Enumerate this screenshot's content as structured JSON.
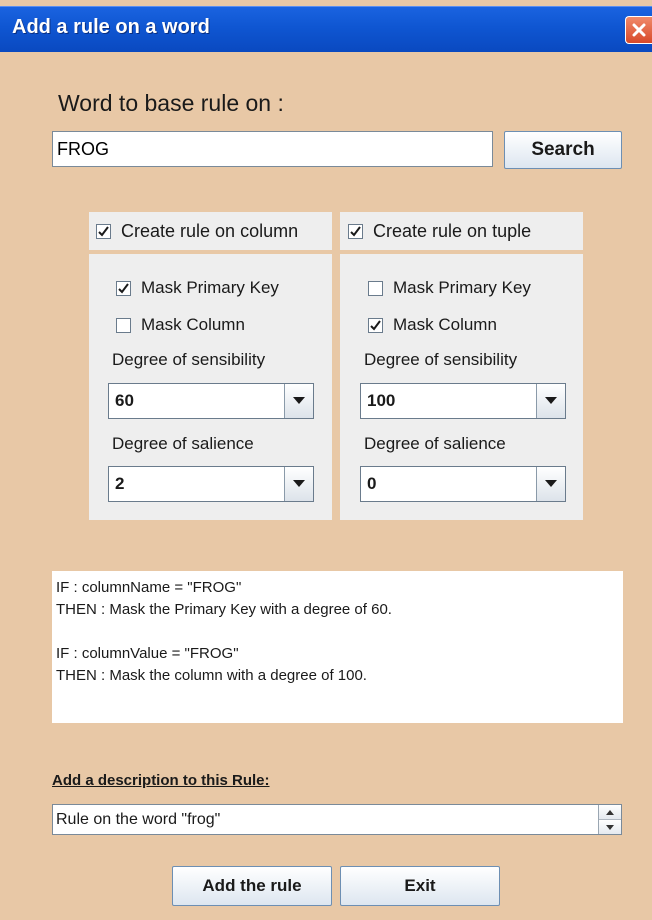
{
  "window": {
    "title": "Add a rule on a word"
  },
  "word_label": "Word to base rule on :",
  "word_input": {
    "value": "FROG"
  },
  "search_button": "Search",
  "column_panel": {
    "header": "Create rule on column",
    "header_checked": true,
    "mask_primary_key": {
      "label": "Mask Primary Key",
      "checked": true
    },
    "mask_column": {
      "label": "Mask Column",
      "checked": false
    },
    "sensibility_label": "Degree of sensibility",
    "sensibility_value": "60",
    "salience_label": "Degree of salience",
    "salience_value": "2"
  },
  "tuple_panel": {
    "header": "Create rule on tuple",
    "header_checked": true,
    "mask_primary_key": {
      "label": "Mask Primary Key",
      "checked": false
    },
    "mask_column": {
      "label": "Mask Column",
      "checked": true
    },
    "sensibility_label": "Degree of sensibility",
    "sensibility_value": "100",
    "salience_label": "Degree of salience",
    "salience_value": "0"
  },
  "rules_preview": {
    "line1": "IF : columnName = \"FROG\"",
    "line2": "THEN :  Mask the Primary Key with a degree of 60.",
    "line3": "IF : columnValue = \"FROG\"",
    "line4": "THEN :  Mask the column with a degree of 100."
  },
  "description_label": "Add a description to this Rule:",
  "description_input": {
    "value": "Rule on the word \"frog\""
  },
  "add_button": "Add the rule",
  "exit_button": "Exit"
}
